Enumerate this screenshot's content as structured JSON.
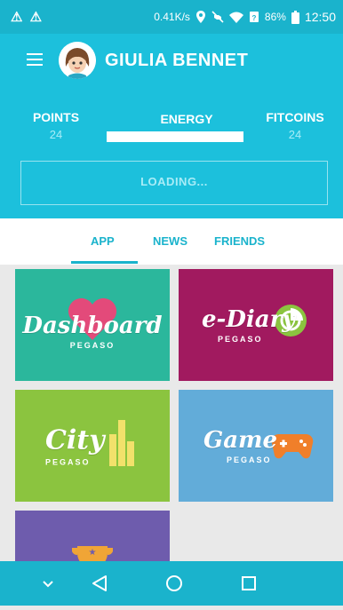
{
  "status_bar": {
    "left_icons": "⚠ ⚠",
    "speed": "0.41K/s",
    "battery": "86%",
    "time": "12:50"
  },
  "header": {
    "user_name": "GIULIA BENNET",
    "stats": {
      "points_label": "POINTS",
      "points_value": "24",
      "energy_label": "ENERGY",
      "fitcoins_label": "FITCOINS",
      "fitcoins_value": "24"
    },
    "loading_text": "LOADING..."
  },
  "tabs": [
    {
      "label": "APP",
      "active": true
    },
    {
      "label": "NEWS",
      "active": false
    },
    {
      "label": "FRIENDS",
      "active": false
    }
  ],
  "tiles": [
    {
      "title": "Dashboard",
      "subtitle": "PEGASO",
      "color": "#2bb79c"
    },
    {
      "title": "e-Diary",
      "subtitle": "PEGASO",
      "color": "#a11a5f"
    },
    {
      "title": "City",
      "subtitle": "PEGASO",
      "color": "#8bc43f"
    },
    {
      "title": "Game",
      "subtitle": "PEGASO",
      "color": "#62acd9"
    },
    {
      "title": "",
      "subtitle": "",
      "color": "#6e5cad"
    }
  ],
  "nav_bar": {
    "icons": [
      "chevron-down-icon",
      "back-icon",
      "home-icon",
      "recents-icon"
    ]
  },
  "colors": {
    "header": "#1cc0dc",
    "status_bar": "#1ab3cc",
    "accent": "#1ab3cc"
  }
}
